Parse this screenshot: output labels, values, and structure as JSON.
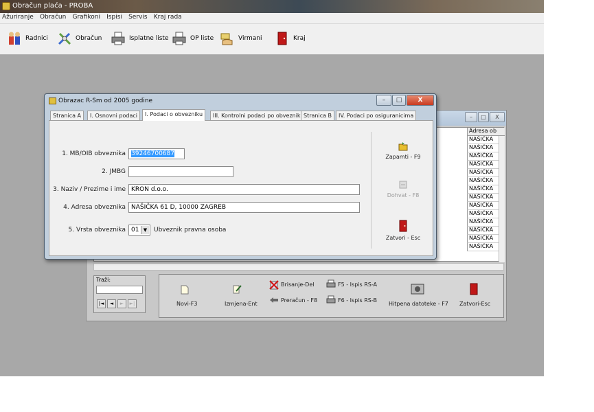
{
  "app": {
    "title": "Obračun plaća - PROBA",
    "menu": [
      "Ažuriranje",
      "Obračun",
      "Grafikoni",
      "Ispisi",
      "Servis",
      "Kraj rada"
    ],
    "toolbar": {
      "radnici": "Radnici",
      "obracun": "Obračun",
      "isplatne": "Isplatne liste",
      "op_liste": "OP liste",
      "virmani": "Virmani",
      "kraj": "Kraj"
    }
  },
  "bg_window": {
    "column_header": "Adresa ob",
    "rows": [
      "NAŠIČKA",
      "NAŠIČKA",
      "NAŠIČKA",
      "NAŠIČKA",
      "NAŠIČKA",
      "NAŠIČKA",
      "NAŠIČKA",
      "NAŠIČKA",
      "NAŠIČKA",
      "NAŠIČKA",
      "NAŠIČKA",
      "NAŠIČKA",
      "NAŠIČKA",
      "NAŠIČKA"
    ],
    "search_label": "Traži:",
    "nav": [
      "|◄",
      "◄",
      "►",
      "►|"
    ],
    "actions": {
      "novi": "Novi-F3",
      "izmjena": "Izmjena-Ent",
      "brisanje": "Brisanje-Del",
      "preracun": "Preračun - F8",
      "f5_ispis": "F5 - Ispis RS-A",
      "f6_ispis": "F6 - Ispis RS-B",
      "hitna": "Hitpena datoteke - F7",
      "zatvori": "Zatvori-Esc"
    }
  },
  "dialog": {
    "title": "Obrazac R-Sm od 2005 godine",
    "tabs": [
      "Stranica A",
      "I. Osnovni podaci",
      "I. Podaci o obvezniku",
      "III. Kontrolni podaci po obvezniku",
      "Stranica B",
      "IV. Podaci po osiguranicima"
    ],
    "active_tab": "I. Podaci o obvezniku",
    "fields": {
      "mb_label": "1. MB/OIB obveznika",
      "mb_value": "39246700687",
      "jmbg_label": "2. JMBG",
      "jmbg_value": "",
      "naziv_label": "3. Naziv / Prezime i ime",
      "naziv_value": "KRON d.o.o.",
      "adresa_label": "4. Adresa obveznika",
      "adresa_value": "NAŠIČKA 61 D, 10000 ZAGREB",
      "vrsta_label": "5. Vrsta obveznika",
      "vrsta_value": "01",
      "vrsta_desc": "Ubveznik pravna osoba"
    },
    "buttons": {
      "zapamti": "Zapamti - F9",
      "dohvat": "Dohvat - F8",
      "zatvori": "Zatvori - Esc"
    }
  }
}
